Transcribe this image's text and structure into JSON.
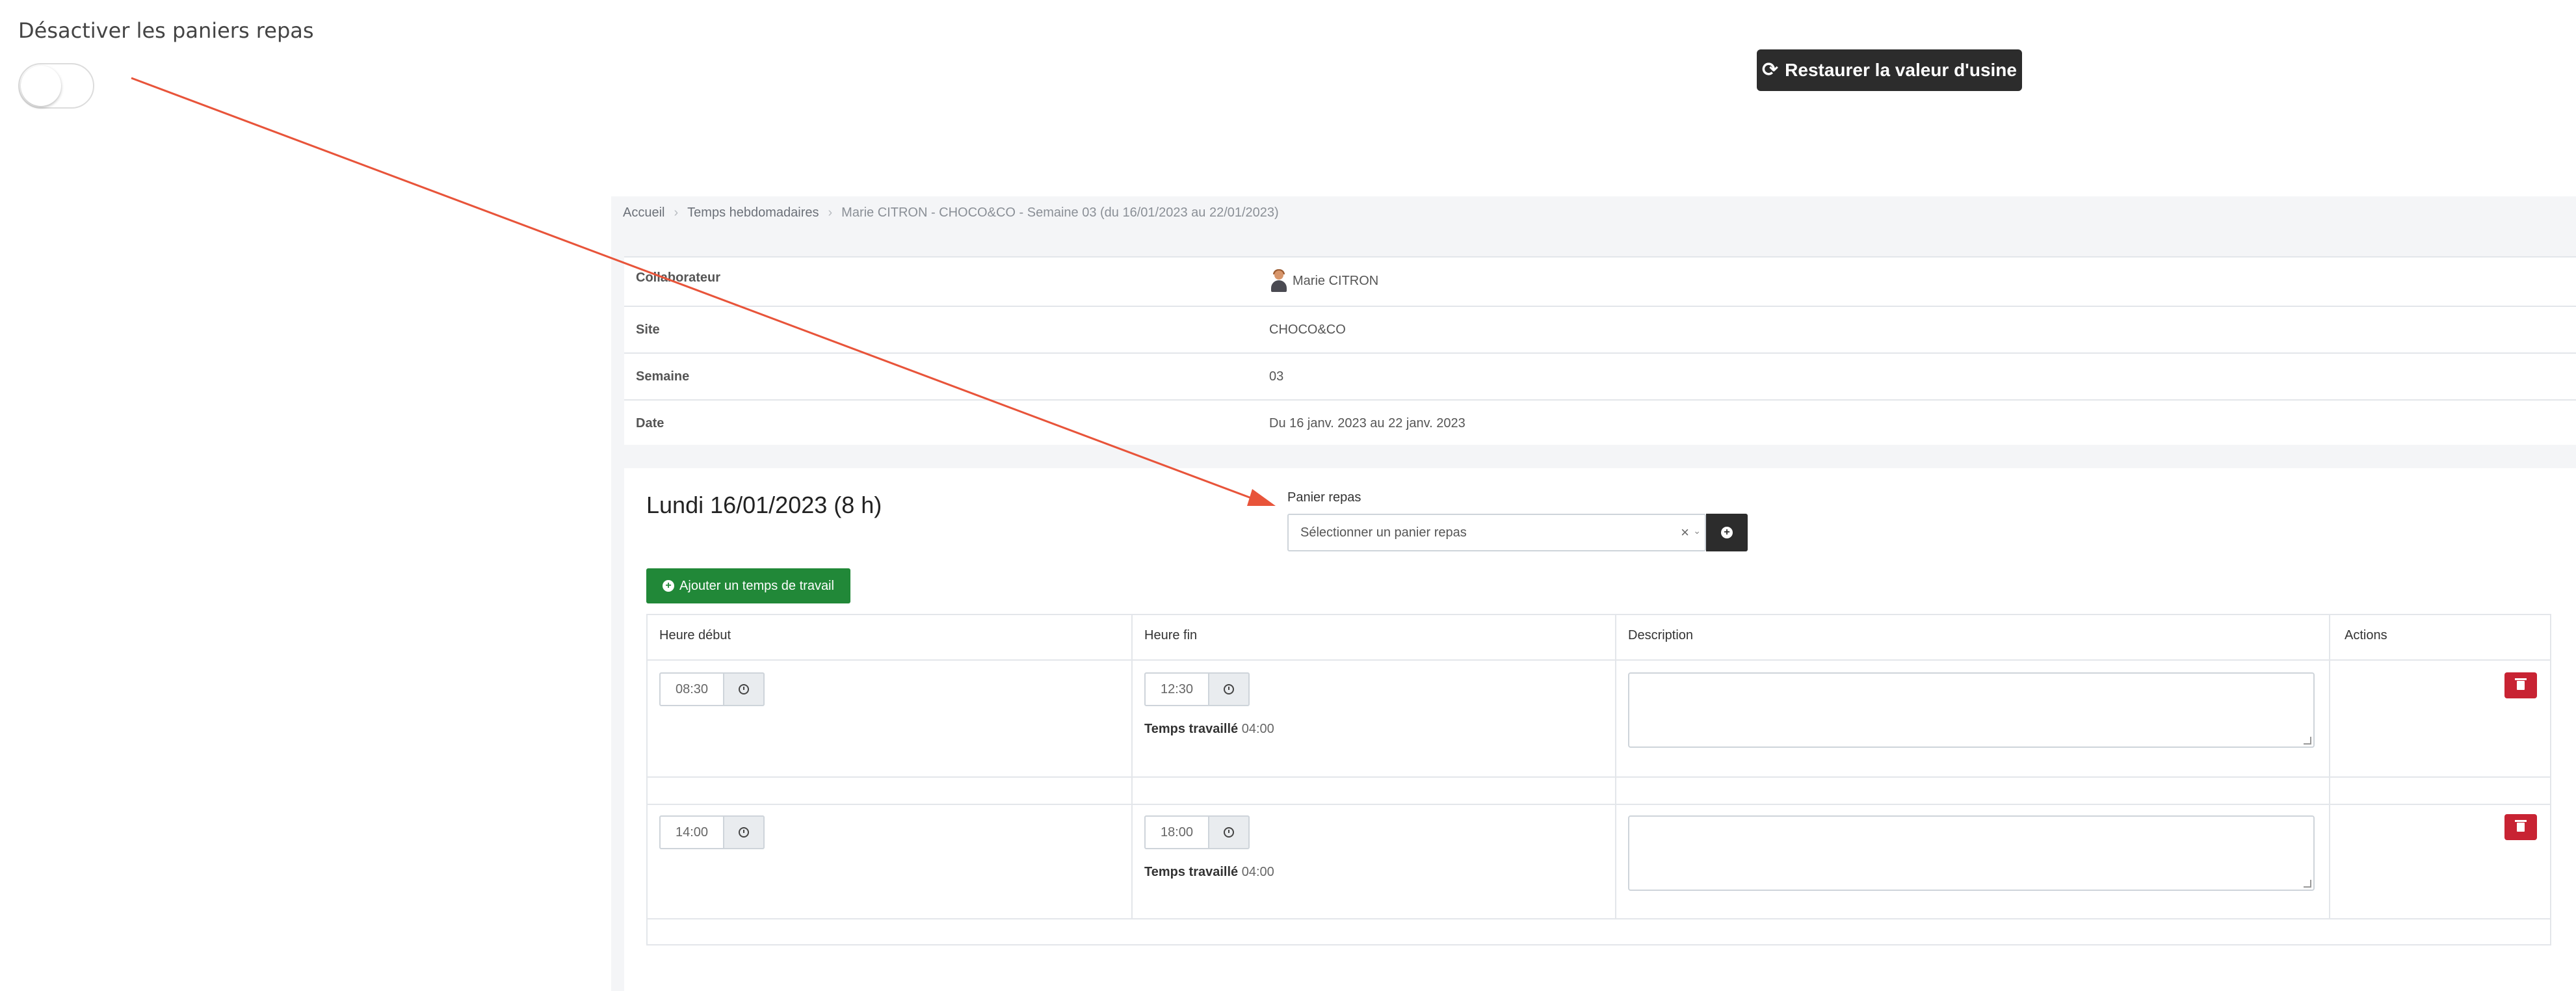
{
  "setting": {
    "title": "Désactiver les paniers repas",
    "toggle_state": "off"
  },
  "restore_button": {
    "icon": "refresh-icon",
    "label": "Restaurer la valeur d'usine"
  },
  "breadcrumb": [
    "Accueil",
    "Temps hebdomadaires",
    "Marie CITRON - CHOCO&CO - Semaine 03 (du 16/01/2023 au 22/01/2023)"
  ],
  "info": {
    "rows": [
      {
        "label": "Collaborateur",
        "value": "Marie CITRON"
      },
      {
        "label": "Site",
        "value": "CHOCO&CO"
      },
      {
        "label": "Semaine",
        "value": "03"
      },
      {
        "label": "Date",
        "value": "Du 16 janv. 2023 au 22 janv. 2023"
      }
    ]
  },
  "day": {
    "title": "Lundi 16/01/2023 (8 h)",
    "panier": {
      "label": "Panier repas",
      "placeholder": "Sélectionner un panier repas",
      "clear_symbol": "×"
    },
    "add_time_label": "Ajouter un temps de travail",
    "table": {
      "headers": [
        "Heure début",
        "Heure fin",
        "Description",
        "Actions"
      ],
      "rows": [
        {
          "start": "08:30",
          "end": "12:30",
          "worked_label": "Temps travaillé",
          "worked": "04:00",
          "description": ""
        },
        {
          "start": "14:00",
          "end": "18:00",
          "worked_label": "Temps travaillé",
          "worked": "04:00",
          "description": ""
        }
      ]
    }
  },
  "colors": {
    "annotation_arrow": "#e8543a",
    "add_button": "#218838",
    "delete_button": "#c82333",
    "dark_button": "#2c2c2c"
  }
}
